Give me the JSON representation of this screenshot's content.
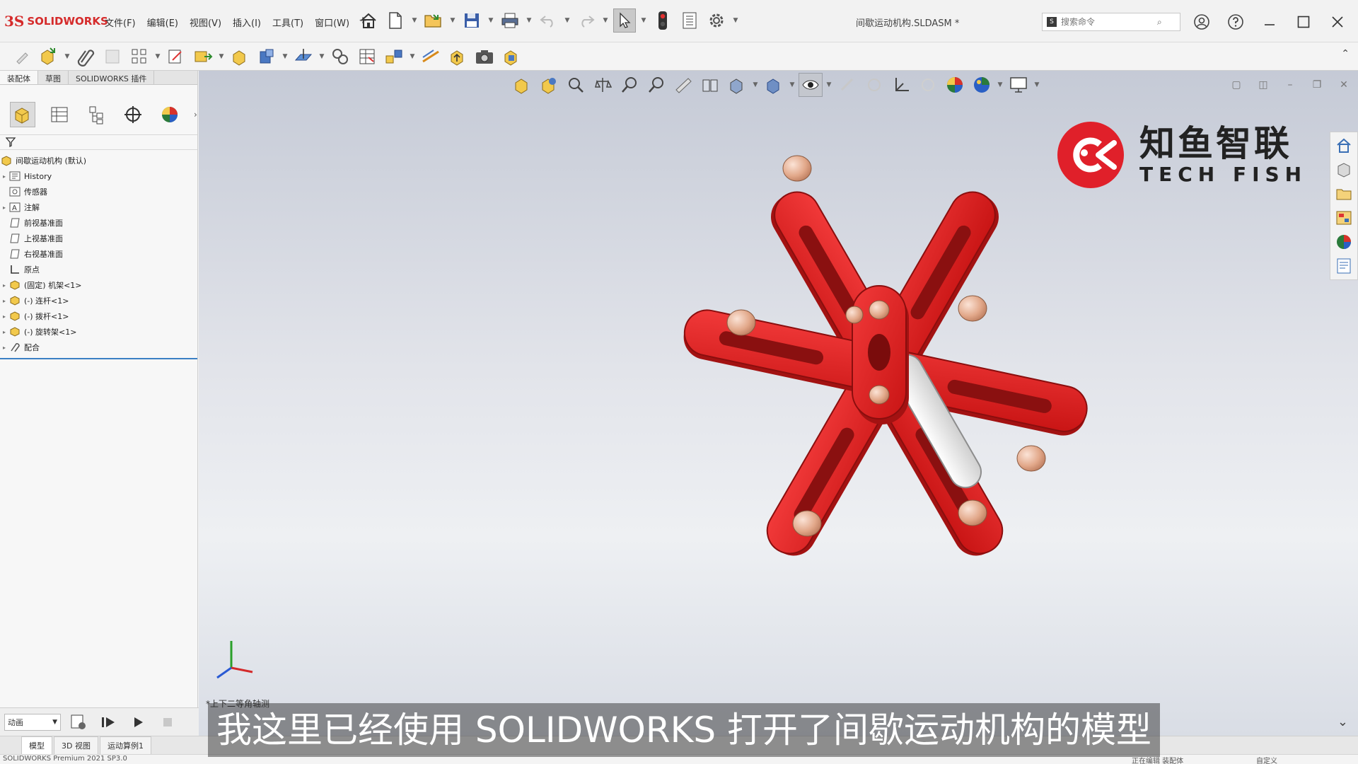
{
  "app": {
    "logo_prefix": "3S",
    "logo_text": "SOLIDWORKS",
    "menu": [
      "文件(F)",
      "编辑(E)",
      "视图(V)",
      "插入(I)",
      "工具(T)",
      "窗口(W)"
    ],
    "menu_pin": "✢",
    "document_title": "间歇运动机构.SLDASM *",
    "search_placeholder": "搜索命令",
    "search_icon_label": "S"
  },
  "command_manager": {
    "tabs": [
      "装配体",
      "草图",
      "SOLIDWORKS 插件"
    ],
    "active_tab": "装配体"
  },
  "feature_tree": {
    "root": "间歇运动机构 (默认)",
    "nodes": [
      {
        "label": "History",
        "icon": "history-icon",
        "expandable": true
      },
      {
        "label": "传感器",
        "icon": "sensor-icon",
        "expandable": false
      },
      {
        "label": "注解",
        "icon": "annotation-icon",
        "expandable": true
      },
      {
        "label": "前视基准面",
        "icon": "plane-icon",
        "expandable": false
      },
      {
        "label": "上视基准面",
        "icon": "plane-icon",
        "expandable": false
      },
      {
        "label": "右视基准面",
        "icon": "plane-icon",
        "expandable": false
      },
      {
        "label": "原点",
        "icon": "origin-icon",
        "expandable": false
      },
      {
        "label": "(固定) 机架<1>",
        "icon": "part-icon",
        "expandable": true
      },
      {
        "label": "(-) 连杆<1>",
        "icon": "part-icon",
        "expandable": true
      },
      {
        "label": "(-) 拨杆<1>",
        "icon": "part-icon",
        "expandable": true
      },
      {
        "label": "(-) 旋转架<1>",
        "icon": "part-icon",
        "expandable": true
      },
      {
        "label": "配合",
        "icon": "mates-icon",
        "expandable": true
      }
    ]
  },
  "viewport": {
    "view_name": "*上下二等角轴测"
  },
  "brand": {
    "name_cn": "知鱼智联",
    "name_en": "TECH FISH",
    "color": "#e0202a"
  },
  "motion": {
    "study_type": "动画"
  },
  "bottom_tabs": [
    "模型",
    "3D 视图",
    "运动算例1"
  ],
  "statusbar": {
    "product": "SOLIDWORKS Premium 2021 SP3.0",
    "mid": "正在编辑 装配体",
    "custom": "自定义"
  },
  "subtitle": "我这里已经使用 SOLIDWORKS 打开了间歇运动机构的模型",
  "colors": {
    "part_red": "#e01f1f",
    "part_red_dark": "#a01010",
    "pin_copper": "#e8b49a",
    "slider_silver": "#e6e6e6",
    "selection_blue": "#3b7fc4"
  }
}
